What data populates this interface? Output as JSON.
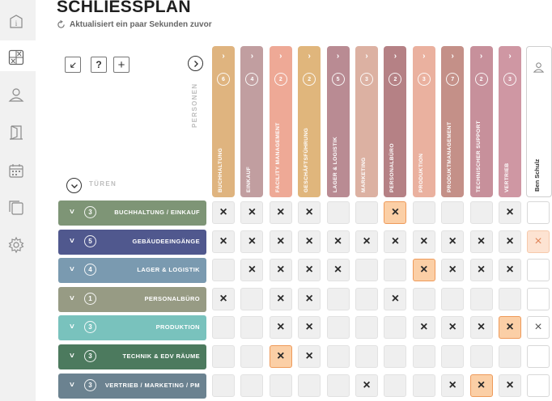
{
  "page": {
    "title": "SCHLIESSPLAN",
    "subtitle": "Aktualisiert ein paar Sekunden zuvor"
  },
  "sidebar": {
    "items": [
      {
        "icon": "info-icon"
      },
      {
        "icon": "schliessplan-icon",
        "active": true
      },
      {
        "icon": "user-icon"
      },
      {
        "icon": "door-icon"
      },
      {
        "icon": "calendar-icon"
      },
      {
        "icon": "copy-icon"
      },
      {
        "icon": "gear-icon"
      }
    ]
  },
  "toolbar": {
    "undo_icon": "undo-icon",
    "help_label": "?",
    "add_label": "+"
  },
  "labels": {
    "personen": "PERSONEN",
    "tueren": "TÜREN"
  },
  "columns": [
    {
      "label": "BUCHHALTUNG",
      "count": "6",
      "color": "#dfb47f"
    },
    {
      "label": "EINKAUF",
      "count": "4",
      "color": "#c19ea0"
    },
    {
      "label": "FACILITY MANAGEMENT",
      "count": "2",
      "color": "#eea996"
    },
    {
      "label": "GESCHÄFTSFÜHRUNG",
      "count": "2",
      "color": "#e0b67c"
    },
    {
      "label": "LAGER & LOGISTIK",
      "count": "5",
      "color": "#b98b93"
    },
    {
      "label": "MARKETING",
      "count": "3",
      "color": "#dcb1a2"
    },
    {
      "label": "PERSONALBÜRO",
      "count": "2",
      "color": "#b58185"
    },
    {
      "label": "PRODUKTION",
      "count": "3",
      "color": "#eab19f"
    },
    {
      "label": "PRODUKTMANAGEMENT",
      "count": "7",
      "color": "#c49088"
    },
    {
      "label": "TECHNISCHER SUPPORT",
      "count": "2",
      "color": "#c7909b"
    },
    {
      "label": "VERTRIEB",
      "count": "3",
      "color": "#cf97a3"
    }
  ],
  "person_column": {
    "label": "Ben Schulz"
  },
  "rows": [
    {
      "label": "BUCHHALTUNG / EINKAUF",
      "count": "3",
      "color": "#7e9576",
      "cells": [
        "x",
        "x",
        "x",
        "x",
        "",
        "",
        "xh",
        "",
        "",
        "",
        "x"
      ],
      "person": ""
    },
    {
      "label": "GEBÄUDEEINGÄNGE",
      "count": "5",
      "color": "#50588e",
      "cells": [
        "x",
        "x",
        "x",
        "x",
        "x",
        "x",
        "x",
        "x",
        "x",
        "x",
        "x"
      ],
      "person": "xh"
    },
    {
      "label": "LAGER & LOGISTIK",
      "count": "4",
      "color": "#7a9ab0",
      "cells": [
        "",
        "x",
        "x",
        "x",
        "x",
        "",
        "",
        "xh",
        "x",
        "x",
        "x"
      ],
      "person": ""
    },
    {
      "label": "PERSONALBÜRO",
      "count": "1",
      "color": "#979b84",
      "cells": [
        "x",
        "",
        "x",
        "x",
        "",
        "",
        "x",
        "",
        "",
        "",
        ""
      ],
      "person": ""
    },
    {
      "label": "PRODUKTION",
      "count": "3",
      "color": "#79c2bd",
      "cells": [
        "",
        "",
        "x",
        "x",
        "",
        "",
        "",
        "x",
        "x",
        "x",
        "xh"
      ],
      "person": "x"
    },
    {
      "label": "TECHNIK & EDV RÄUME",
      "count": "3",
      "color": "#4c7a5e",
      "cells": [
        "",
        "",
        "xh",
        "x",
        "",
        "",
        "",
        "",
        "",
        "",
        ""
      ],
      "person": ""
    },
    {
      "label": "VERTRIEB / MARKETING / PM",
      "count": "3",
      "color": "#6b8290",
      "cells": [
        "",
        "",
        "",
        "",
        "",
        "x",
        "",
        "",
        "x",
        "xh",
        "x"
      ],
      "person": ""
    }
  ],
  "mark_symbol": "×"
}
